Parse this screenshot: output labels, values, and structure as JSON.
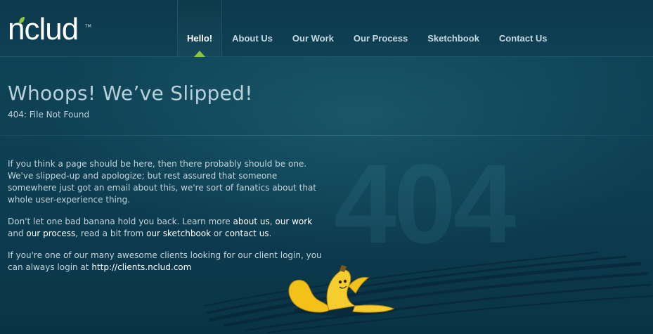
{
  "brand": {
    "logo_text": "nclud",
    "trademark": "TM",
    "accent_color": "#8cc43f"
  },
  "nav": {
    "items": [
      {
        "label": "Hello!",
        "active": true
      },
      {
        "label": "About Us",
        "active": false
      },
      {
        "label": "Our Work",
        "active": false
      },
      {
        "label": "Our Process",
        "active": false
      },
      {
        "label": "Sketchbook",
        "active": false
      },
      {
        "label": "Contact Us",
        "active": false
      }
    ]
  },
  "page": {
    "title": "Whoops! We’ve Slipped!",
    "subtitle": "404: File Not Found",
    "watermark": "404"
  },
  "content": {
    "p1": "If you think a page should be here, then there probably should be one. We've slipped-up and apologize; but rest assured that someone somewhere just got an email about this, we're sort of fanatics about that whole user-experience thing.",
    "p2": {
      "t1": "Don't let one bad banana hold you back. Learn more ",
      "link_about": "about us",
      "t2": ", ",
      "link_work": "our work",
      "t3": " and ",
      "link_process": "our process",
      "t4": ", read a bit from ",
      "link_sketchbook": "our sketchbook",
      "t5": " or ",
      "link_contact": "contact us",
      "t6": "."
    },
    "p3": {
      "t1": "If you're one of our many awesome clients looking for our client login, you can always login at ",
      "link_login": "http://clients.nclud.com"
    }
  },
  "colors": {
    "background": "#0f4356",
    "banana": "#f2c21b"
  },
  "illustration": {
    "icon": "banana-peel-icon"
  }
}
